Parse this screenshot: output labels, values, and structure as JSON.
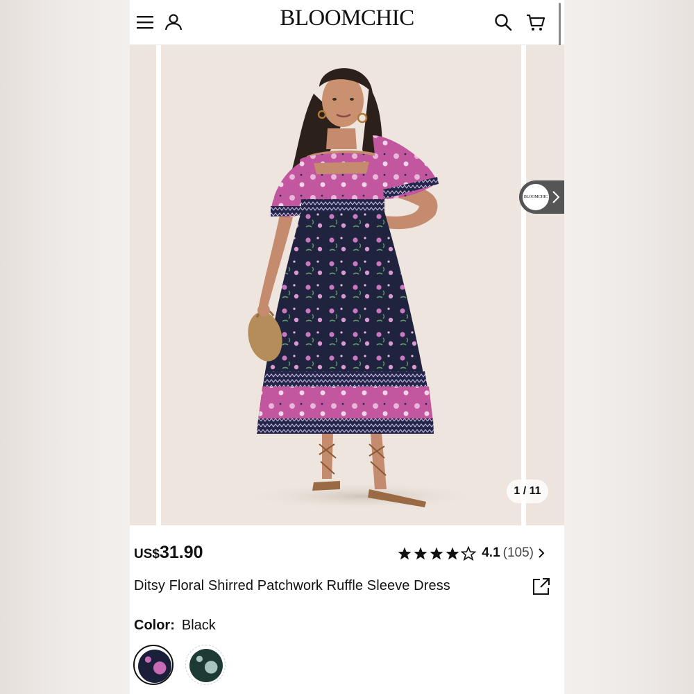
{
  "header": {
    "logo": "BLOOMCHIC",
    "icons": [
      "menu-icon",
      "account-icon",
      "search-icon",
      "cart-icon"
    ]
  },
  "gallery": {
    "counter": "1 / 11",
    "brand_badge": "BLOOMCHIC",
    "background_color": "#ede5de"
  },
  "product": {
    "currency": "US$",
    "price": "31.90",
    "rating_value": "4.1",
    "rating_count": "(105)",
    "stars_filled": 4,
    "stars_total": 5,
    "title": "Ditsy Floral Shirred Patchwork Ruffle Sleeve Dress",
    "color_label": "Color:",
    "color_value": "Black",
    "swatches": [
      {
        "color": "#1b1f3a",
        "accent": "#c86bb4",
        "selected": true
      },
      {
        "color": "#1d3a34",
        "accent": "#a7c4c0",
        "selected": false
      }
    ]
  }
}
